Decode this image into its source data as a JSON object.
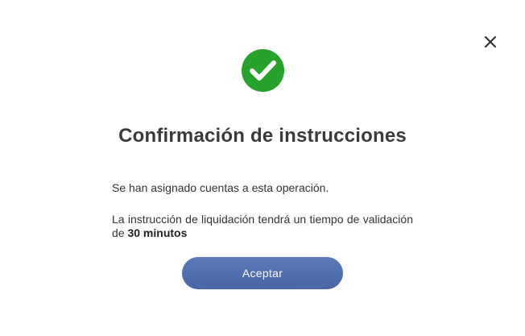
{
  "dialog": {
    "title": "Confirmación de instrucciones",
    "message_1": "Se han asignado cuentas a esta operación.",
    "message_2_prefix": "La instrucción de liquidación tendrá un tiempo de validación de ",
    "message_2_emphasis": "30 minutos",
    "accept_label": "Aceptar"
  },
  "icons": {
    "success": "check-circle-icon",
    "close": "close-icon"
  },
  "colors": {
    "success_green": "#27a22a",
    "button_blue": "#4f6fb0",
    "title_text": "#3a3a3a"
  }
}
